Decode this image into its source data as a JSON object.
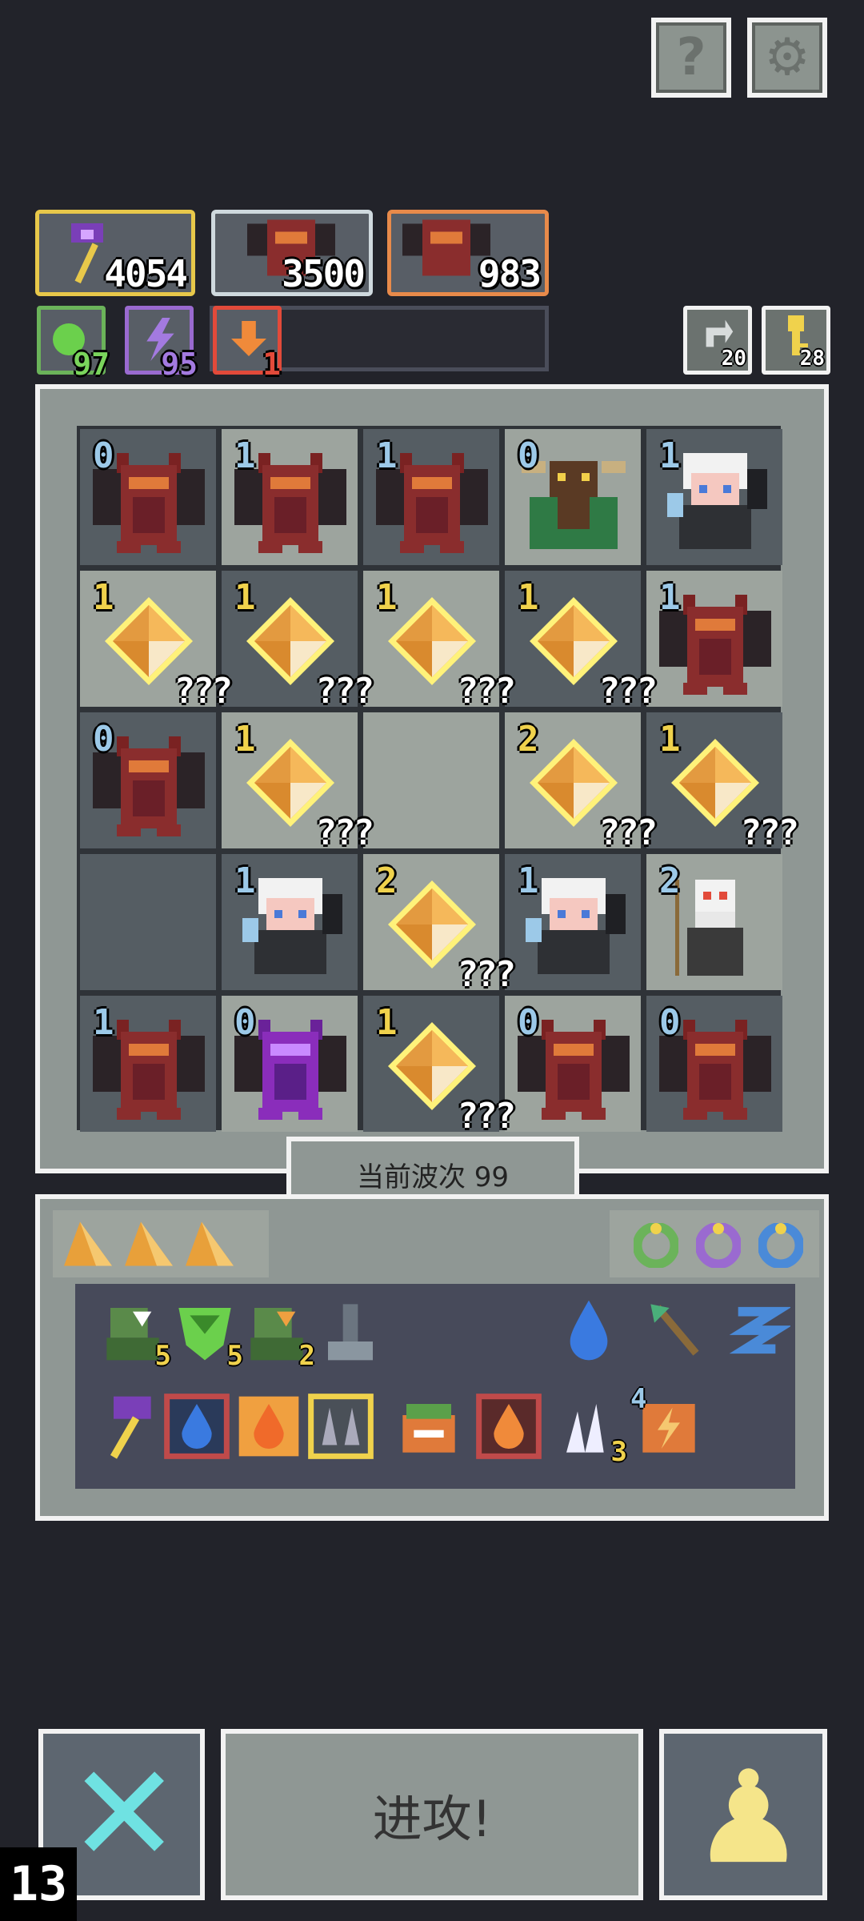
{
  "top_buttons": [
    {
      "name": "help-button",
      "glyph": "?"
    },
    {
      "name": "settings-button",
      "glyph": "⚙"
    }
  ],
  "resources": [
    {
      "name": "attack-power",
      "value": "4054",
      "border": "#e8c84a"
    },
    {
      "name": "dragon-count-white",
      "value": "3500",
      "border": "#cfd9de"
    },
    {
      "name": "dragon-count-orange",
      "value": "983",
      "border": "#e88a4a"
    }
  ],
  "buffs": [
    {
      "name": "green-buff",
      "value": "97",
      "color": "#7ad45c"
    },
    {
      "name": "purple-buff",
      "value": "95",
      "color": "#a37ae0"
    },
    {
      "name": "orange-buff",
      "value": "1",
      "color": "#e24a3a"
    }
  ],
  "right_counters": [
    {
      "name": "swap-counter",
      "value": "20"
    },
    {
      "name": "key-counter",
      "value": "28"
    }
  ],
  "board": {
    "rows": [
      [
        {
          "t": "dragon",
          "lvl": "0",
          "lc": "b"
        },
        {
          "t": "dragon",
          "lvl": "1",
          "lc": "b"
        },
        {
          "t": "dragon",
          "lvl": "1",
          "lc": "b"
        },
        {
          "t": "minotaur",
          "lvl": "0",
          "lc": "b"
        },
        {
          "t": "witch",
          "lvl": "1",
          "lc": "b"
        }
      ],
      [
        {
          "t": "gem",
          "lvl": "1",
          "lc": "y",
          "q": "???"
        },
        {
          "t": "gem",
          "lvl": "1",
          "lc": "y",
          "q": "???"
        },
        {
          "t": "gem",
          "lvl": "1",
          "lc": "y",
          "q": "???"
        },
        {
          "t": "gem",
          "lvl": "1",
          "lc": "y",
          "q": "???"
        },
        {
          "t": "dragon",
          "lvl": "1",
          "lc": "b"
        }
      ],
      [
        {
          "t": "dragon",
          "lvl": "0",
          "lc": "b"
        },
        {
          "t": "gem",
          "lvl": "1",
          "lc": "y",
          "q": "???"
        },
        {
          "t": "empty"
        },
        {
          "t": "gem",
          "lvl": "2",
          "lc": "y",
          "q": "???"
        },
        {
          "t": "gem",
          "lvl": "1",
          "lc": "y",
          "q": "???"
        }
      ],
      [
        {
          "t": "empty"
        },
        {
          "t": "witch",
          "lvl": "1",
          "lc": "b"
        },
        {
          "t": "gem",
          "lvl": "2",
          "lc": "y",
          "q": "???"
        },
        {
          "t": "witch",
          "lvl": "1",
          "lc": "b"
        },
        {
          "t": "wizard",
          "lvl": "2",
          "lc": "b"
        }
      ],
      [
        {
          "t": "dragon",
          "lvl": "1",
          "lc": "b"
        },
        {
          "t": "purple-dragon",
          "lvl": "0",
          "lc": "b"
        },
        {
          "t": "gem",
          "lvl": "1",
          "lc": "y",
          "q": "???"
        },
        {
          "t": "dragon",
          "lvl": "0",
          "lc": "b"
        },
        {
          "t": "dragon",
          "lvl": "0",
          "lc": "b"
        }
      ]
    ]
  },
  "wave": {
    "label": "当前波次 99"
  },
  "inventory": {
    "shards": [
      "shard-icon",
      "shard-icon",
      "shard-icon"
    ],
    "rings": [
      {
        "name": "green-ring-icon",
        "color": "#6bb35a"
      },
      {
        "name": "purple-ring-icon",
        "color": "#9a6ad0"
      },
      {
        "name": "blue-ring-icon",
        "color": "#4a8ad8"
      }
    ],
    "row1": [
      {
        "name": "goblin-white-arrow-icon",
        "count": "5"
      },
      {
        "name": "green-gem-shield-icon",
        "count": "5"
      },
      {
        "name": "goblin-orange-arrow-icon",
        "count": "2"
      },
      {
        "name": "hammer-icon",
        "count": ""
      },
      {
        "name": "water-drop-icon",
        "count": ""
      },
      {
        "name": "arrow-icon",
        "count": ""
      },
      {
        "name": "blue-serpent-icon",
        "count": ""
      }
    ],
    "row2": [
      {
        "name": "magic-axe-icon",
        "count": ""
      },
      {
        "name": "water-tile-icon",
        "count": ""
      },
      {
        "name": "fire-tile-icon",
        "count": ""
      },
      {
        "name": "spike-trap-icon",
        "count": ""
      },
      {
        "name": "mimic-chest-icon",
        "count": ""
      },
      {
        "name": "fire-orb-icon",
        "count": ""
      },
      {
        "name": "claw-icon",
        "count": "3"
      },
      {
        "name": "lightning-scroll-icon",
        "count": "4"
      }
    ]
  },
  "bottom": {
    "cancel_glyph": "✕",
    "attack_label": "进攻!",
    "pawn_glyph": "♟",
    "corner_counter": "13"
  }
}
